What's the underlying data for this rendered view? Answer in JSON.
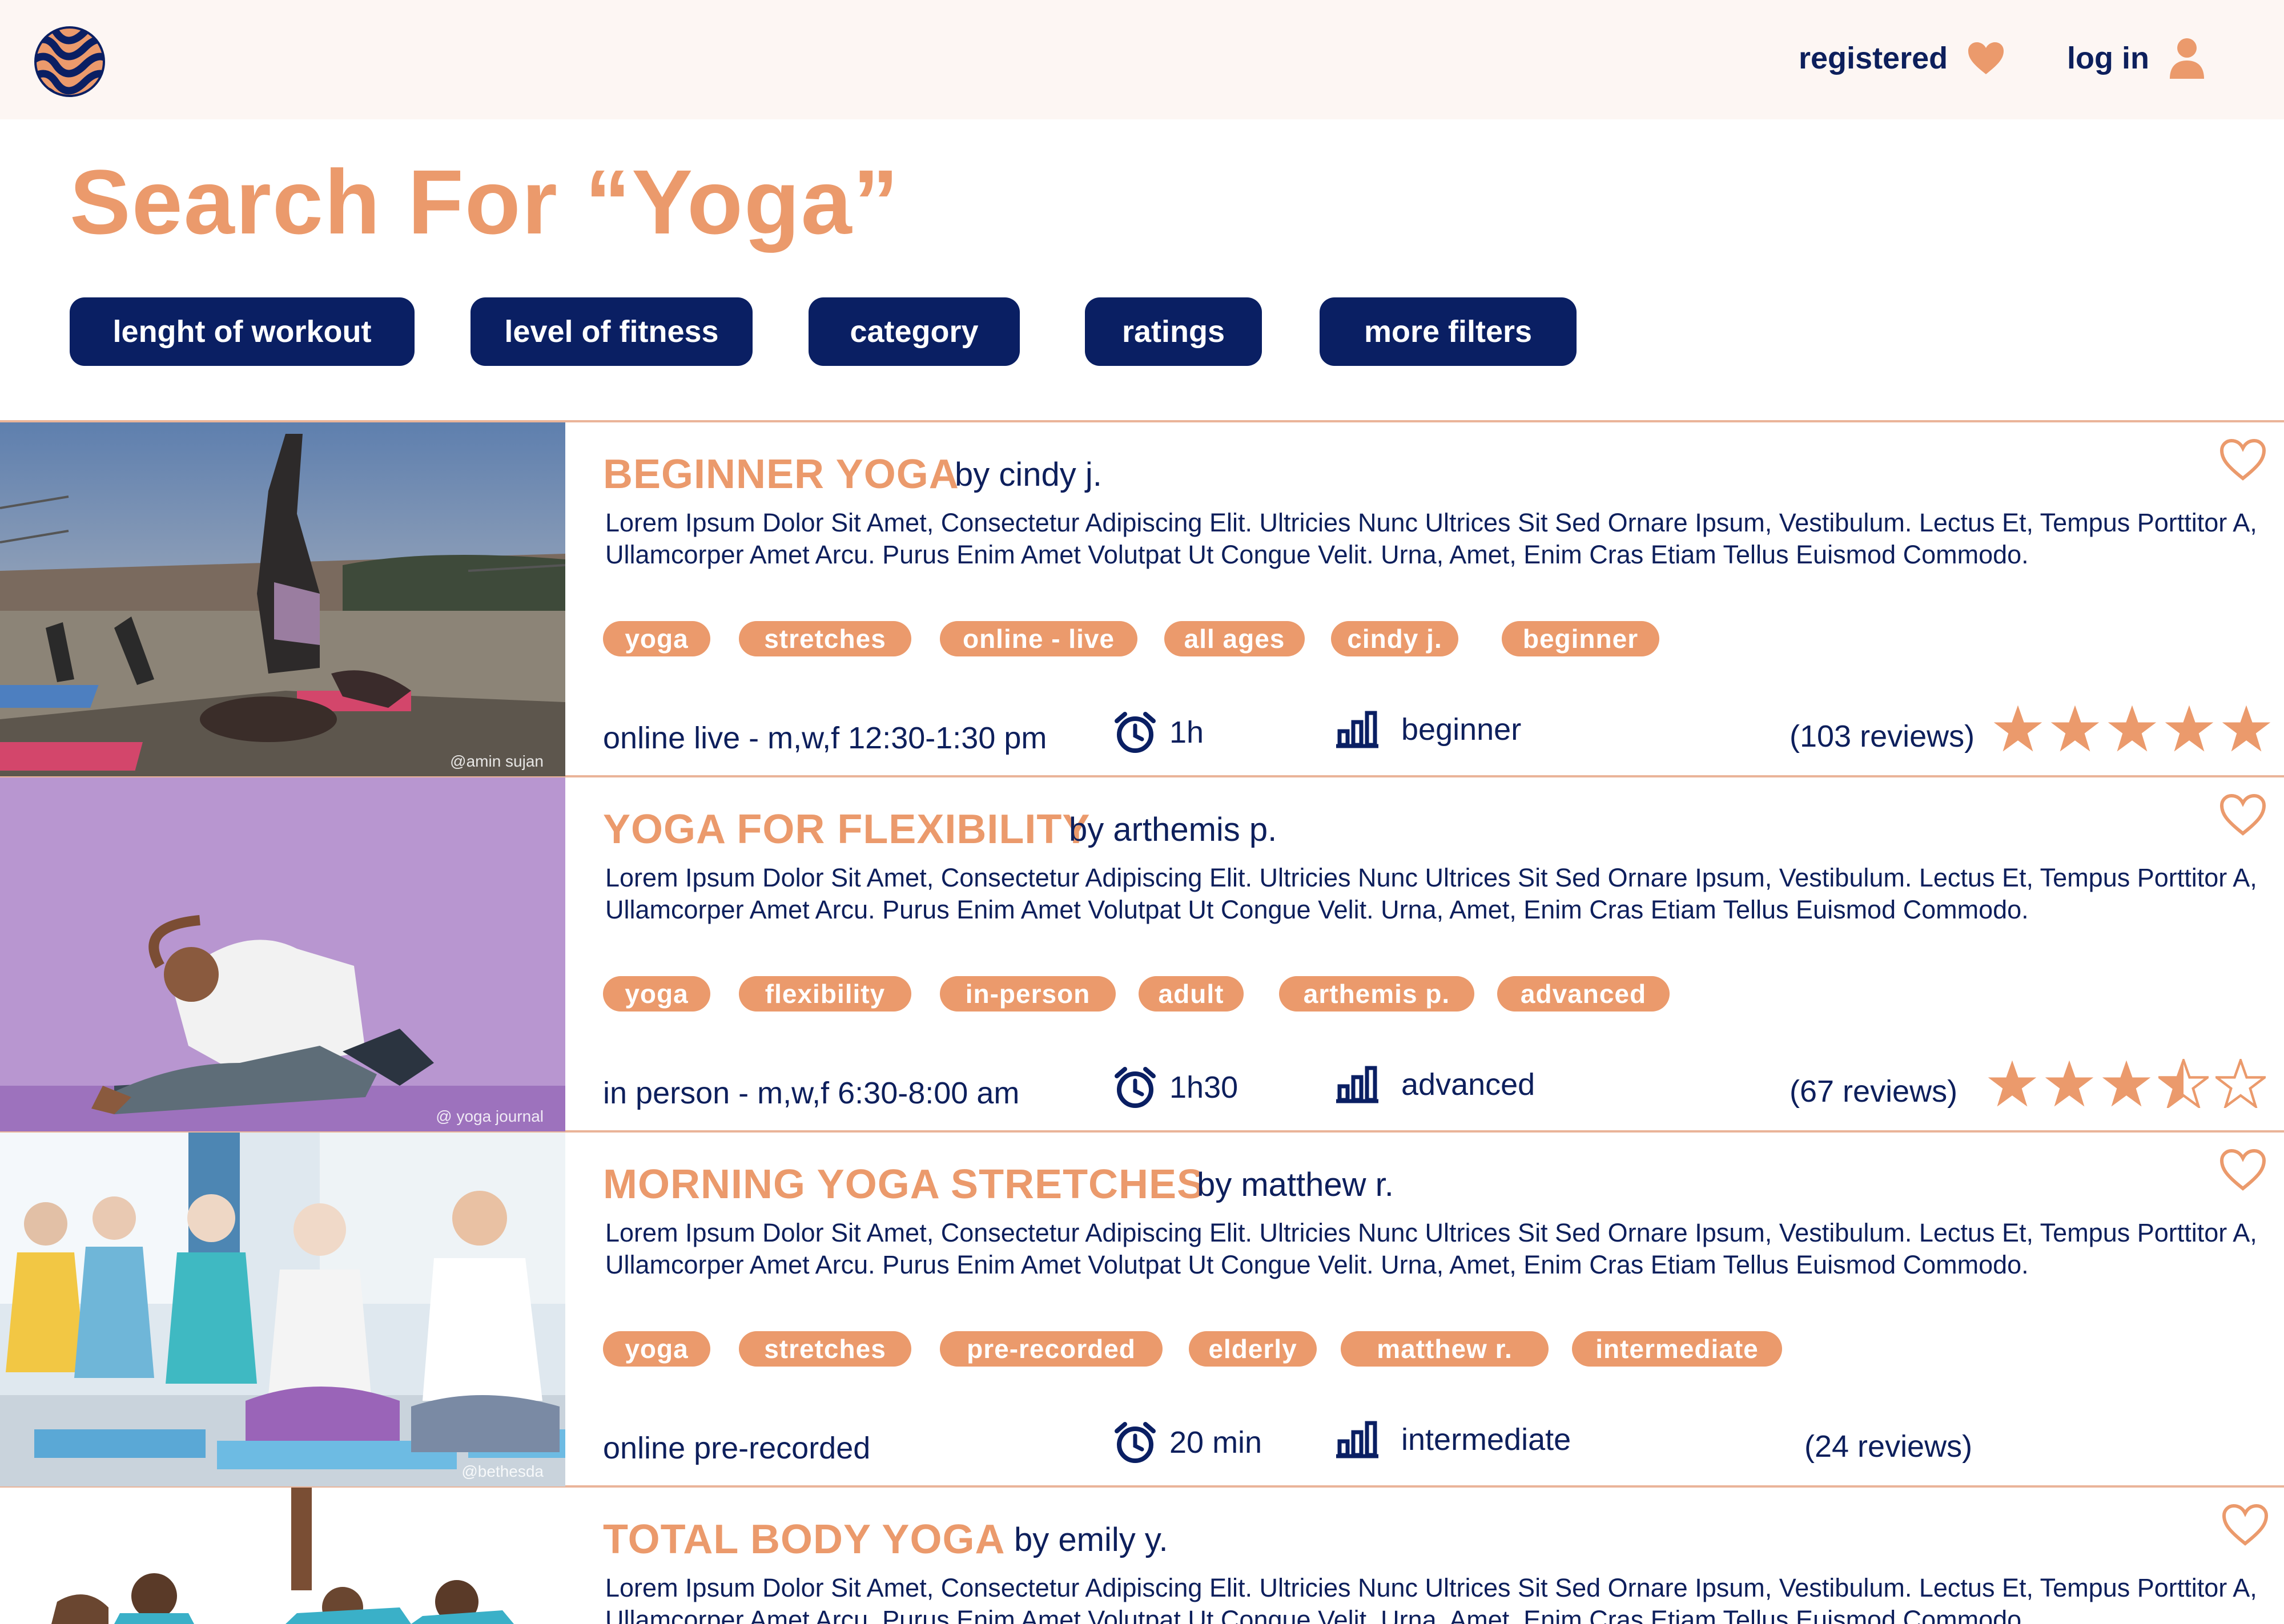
{
  "header": {
    "registered_label": "registered",
    "login_label": "log in"
  },
  "page_title": "Search For “Yoga”",
  "filters": [
    {
      "label": "lenght of workout"
    },
    {
      "label": "level of fitness"
    },
    {
      "label": "category"
    },
    {
      "label": "ratings"
    },
    {
      "label": "more filters"
    }
  ],
  "results": [
    {
      "title": "BEGINNER YOGA",
      "author": "by cindy j.",
      "description": "Lorem Ipsum Dolor Sit Amet, Consectetur Adipiscing Elit. Ultricies Nunc Ultrices Sit Sed Ornare Ipsum, Vestibulum. Lectus Et, Tempus Porttitor A, Ullamcorper Amet Arcu. Purus Enim Amet Volutpat Ut Congue Velit. Urna, Amet, Enim Cras Etiam Tellus Euismod Commodo.",
      "tags": [
        "yoga",
        "stretches",
        "online - live",
        "all ages",
        "cindy j.",
        "beginner"
      ],
      "schedule": "online live - m,w,f  12:30-1:30 pm",
      "duration": "1h",
      "level": "beginner",
      "reviews": "(103 reviews)",
      "rating": 5,
      "image_credit": "@amin sujan"
    },
    {
      "title": "YOGA FOR FLEXIBILITY",
      "author": "by arthemis p.",
      "description": "Lorem Ipsum Dolor Sit Amet, Consectetur Adipiscing Elit. Ultricies Nunc Ultrices Sit Sed Ornare Ipsum, Vestibulum. Lectus Et, Tempus Porttitor A, Ullamcorper Amet Arcu. Purus Enim Amet Volutpat Ut Congue Velit. Urna, Amet, Enim Cras Etiam Tellus Euismod Commodo.",
      "tags": [
        "yoga",
        "flexibility",
        "in-person",
        "adult",
        "arthemis p.",
        "advanced"
      ],
      "schedule": "in person - m,w,f  6:30-8:00 am",
      "duration": "1h30",
      "level": "advanced",
      "reviews": "(67 reviews)",
      "rating": 3.5,
      "image_credit": "@ yoga journal"
    },
    {
      "title": "MORNING YOGA STRETCHES",
      "author": "by matthew r.",
      "description": "Lorem Ipsum Dolor Sit Amet, Consectetur Adipiscing Elit. Ultricies Nunc Ultrices Sit Sed Ornare Ipsum, Vestibulum. Lectus Et, Tempus Porttitor A, Ullamcorper Amet Arcu. Purus Enim Amet Volutpat Ut Congue Velit. Urna, Amet, Enim Cras Etiam Tellus Euismod Commodo.",
      "tags": [
        "yoga",
        "stretches",
        "pre-recorded",
        "elderly",
        "matthew r.",
        "intermediate"
      ],
      "schedule": "online pre-recorded",
      "duration": "20 min",
      "level": "intermediate",
      "reviews": "(24 reviews)",
      "rating": 0,
      "image_credit": "@bethesda"
    },
    {
      "title": "TOTAL BODY YOGA",
      "author": "by emily y.",
      "description": "Lorem Ipsum Dolor Sit Amet, Consectetur Adipiscing Elit. Ultricies Nunc Ultrices Sit Sed Ornare Ipsum, Vestibulum. Lectus Et, Tempus Porttitor A, Ullamcorper Amet Arcu. Purus Enim Amet Volutpat Ut Congue Velit. Urna, Amet, Enim Cras Etiam Tellus Euismod Commodo."
    }
  ],
  "colors": {
    "accent": "#eb9a6c",
    "navy": "#0a1f63",
    "header_bg": "#fdf6f3"
  }
}
